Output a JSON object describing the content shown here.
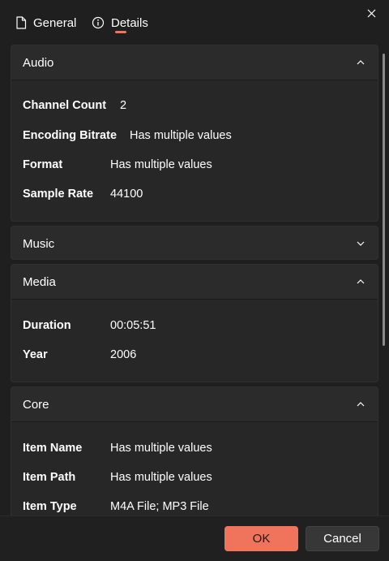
{
  "tabs": {
    "general": "General",
    "details": "Details"
  },
  "colors": {
    "accent": "#f0735b",
    "background": "#1f1f1f",
    "card": "#2b2b2b"
  },
  "sections": {
    "audio": {
      "title": "Audio",
      "expanded": true,
      "rows": [
        {
          "label": "Channel Count",
          "value": "2"
        },
        {
          "label": "Encoding Bitrate",
          "value": "Has multiple values"
        },
        {
          "label": "Format",
          "value": "Has multiple values"
        },
        {
          "label": "Sample Rate",
          "value": "44100"
        }
      ]
    },
    "music": {
      "title": "Music",
      "expanded": false
    },
    "media": {
      "title": "Media",
      "expanded": true,
      "rows": [
        {
          "label": "Duration",
          "value": "00:05:51"
        },
        {
          "label": "Year",
          "value": "2006"
        }
      ]
    },
    "core": {
      "title": "Core",
      "expanded": true,
      "rows": [
        {
          "label": "Item Name",
          "value": "Has multiple values"
        },
        {
          "label": "Item Path",
          "value": "Has multiple values"
        },
        {
          "label": "Item Type",
          "value": "M4A File; MP3 File"
        }
      ]
    }
  },
  "footer": {
    "ok_label": "OK",
    "cancel_label": "Cancel"
  }
}
